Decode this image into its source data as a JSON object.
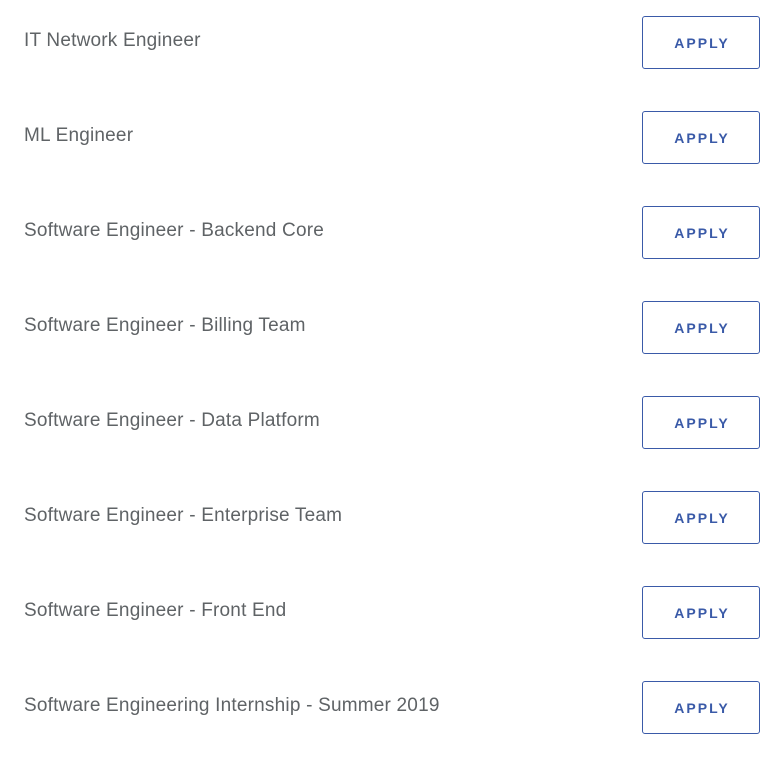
{
  "jobs": [
    {
      "title": "IT Network Engineer",
      "action_label": "APPLY"
    },
    {
      "title": "ML Engineer",
      "action_label": "APPLY"
    },
    {
      "title": "Software Engineer - Backend Core",
      "action_label": "APPLY"
    },
    {
      "title": "Software Engineer - Billing Team",
      "action_label": "APPLY"
    },
    {
      "title": "Software Engineer - Data Platform",
      "action_label": "APPLY"
    },
    {
      "title": "Software Engineer - Enterprise Team",
      "action_label": "APPLY"
    },
    {
      "title": "Software Engineer - Front End",
      "action_label": "APPLY"
    },
    {
      "title": "Software Engineering Internship - Summer 2019",
      "action_label": "APPLY"
    }
  ],
  "colors": {
    "title_text": "#5f6366",
    "accent": "#3a5aa8",
    "background": "#ffffff"
  }
}
